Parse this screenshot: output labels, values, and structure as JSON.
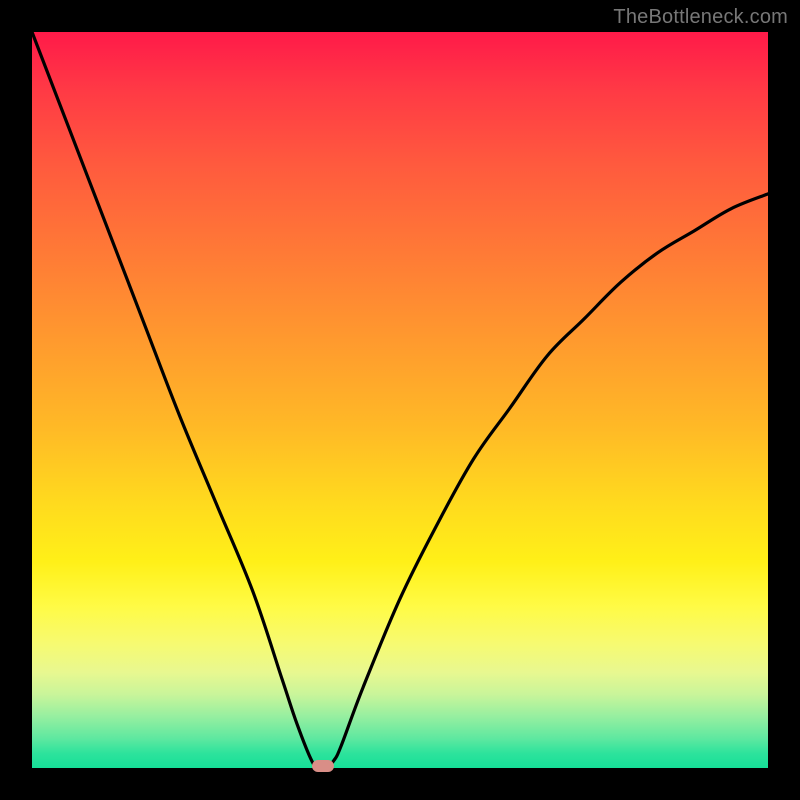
{
  "watermark": "TheBottleneck.com",
  "colors": {
    "frame": "#000000",
    "curve": "#000000",
    "marker": "#d98e87",
    "watermark": "#777777"
  },
  "chart_data": {
    "type": "line",
    "title": "",
    "xlabel": "",
    "ylabel": "",
    "xlim": [
      0,
      100
    ],
    "ylim": [
      0,
      100
    ],
    "grid": false,
    "series": [
      {
        "name": "bottleneck-curve",
        "x": [
          0,
          5,
          10,
          15,
          20,
          25,
          30,
          34,
          36,
          38,
          39,
          40,
          41,
          42,
          45,
          50,
          55,
          60,
          65,
          70,
          75,
          80,
          85,
          90,
          95,
          100
        ],
        "y": [
          100,
          87,
          74,
          61,
          48,
          36,
          24,
          12,
          6,
          1,
          0,
          0,
          1,
          3,
          11,
          23,
          33,
          42,
          49,
          56,
          61,
          66,
          70,
          73,
          76,
          78
        ]
      }
    ],
    "annotations": [
      {
        "name": "min-marker",
        "x": 39.5,
        "y": 0
      }
    ],
    "background_gradient": {
      "direction": "top-to-bottom",
      "stops": [
        {
          "pos": 0,
          "color": "#ff1a49"
        },
        {
          "pos": 50,
          "color": "#ffba26"
        },
        {
          "pos": 78,
          "color": "#fffb45"
        },
        {
          "pos": 100,
          "color": "#16df98"
        }
      ]
    }
  }
}
